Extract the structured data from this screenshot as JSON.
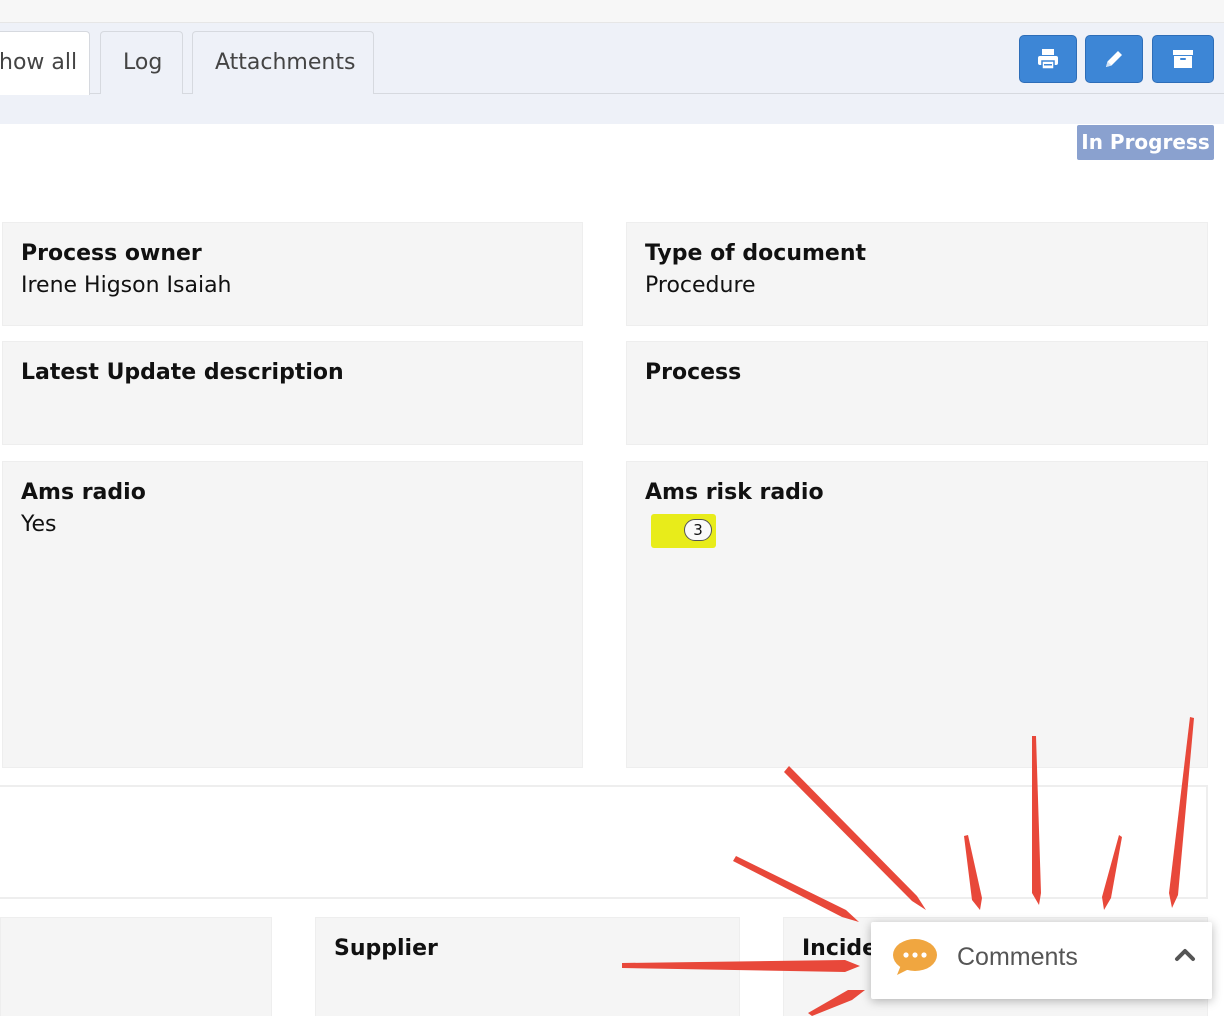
{
  "tabs": [
    {
      "label": "how all",
      "active": true
    },
    {
      "label": "Log",
      "active": false
    },
    {
      "label": "Attachments",
      "active": false
    }
  ],
  "toolbar": {
    "icons": [
      "print-icon",
      "edit-icon",
      "archive-icon"
    ],
    "button_color": "#3d86d6"
  },
  "status": {
    "label": "In Progress",
    "color": "#8aa1cf"
  },
  "fields": {
    "process_owner": {
      "label": "Process owner",
      "value": "Irene Higson Isaiah"
    },
    "type_of_document": {
      "label": "Type of document",
      "value": "Procedure"
    },
    "latest_update": {
      "label": "Latest Update description",
      "value": ""
    },
    "process": {
      "label": "Process",
      "value": ""
    },
    "ams_radio": {
      "label": "Ams radio",
      "value": "Yes"
    },
    "ams_risk_radio": {
      "label": "Ams risk radio",
      "value": "3",
      "color": "#e8ec1a"
    }
  },
  "bottom_fields": {
    "supplier": {
      "label": "Supplier"
    },
    "incident": {
      "label": "Incide"
    }
  },
  "comments_widget": {
    "label": "Comments",
    "icon": "chat-bubble-icon",
    "toggle_icon": "chevron-up-icon",
    "icon_color": "#f0a640"
  },
  "annotation_color": "#e8483a"
}
